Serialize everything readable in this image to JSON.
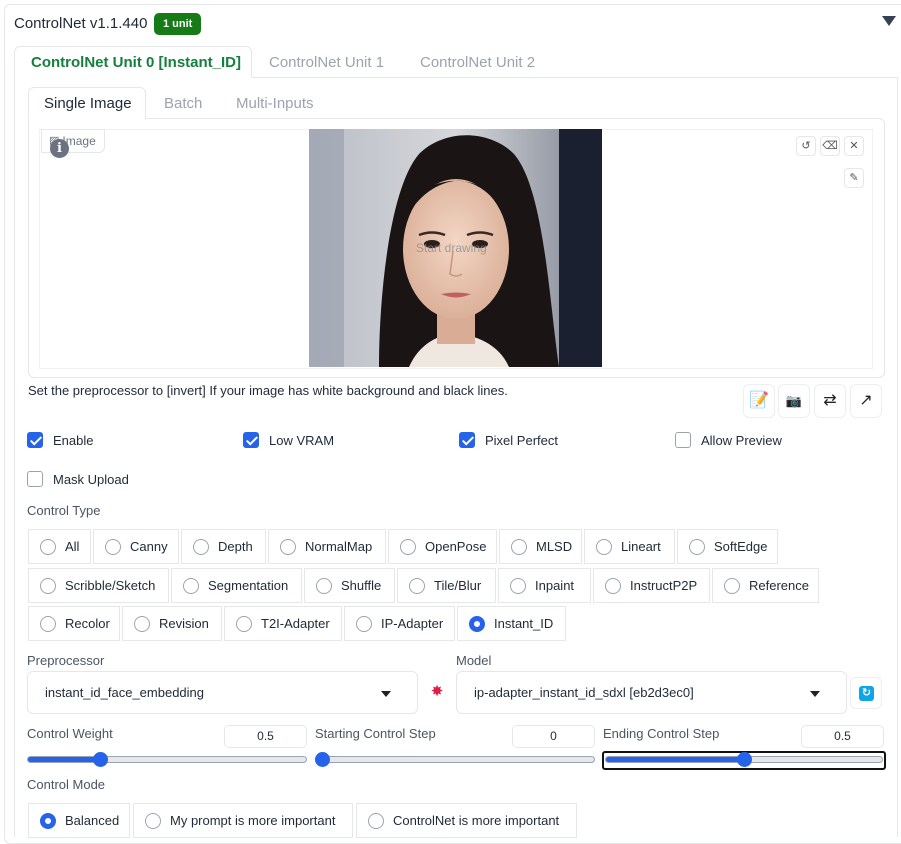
{
  "header": {
    "title": "ControlNet v1.1.440",
    "badge": "1 unit"
  },
  "unit_tabs": [
    {
      "label": "ControlNet Unit 0 [Instant_ID]",
      "active": true
    },
    {
      "label": "ControlNet Unit 1",
      "active": false
    },
    {
      "label": "ControlNet Unit 2",
      "active": false
    }
  ],
  "input_tabs": [
    {
      "label": "Single Image",
      "active": true
    },
    {
      "label": "Batch",
      "active": false
    },
    {
      "label": "Multi-Inputs",
      "active": false
    }
  ],
  "image_panel": {
    "label": "Image",
    "overlay_text": "Start drawing",
    "icons": [
      "undo-icon",
      "erase-icon",
      "close-icon",
      "brush-icon"
    ]
  },
  "hint": "Set the preprocessor to [invert] If your image has white background and black lines.",
  "tool_buttons": [
    {
      "name": "edit-image-icon",
      "glyph": "📝"
    },
    {
      "name": "camera-icon",
      "glyph": "📷"
    },
    {
      "name": "swap-icon",
      "glyph": "⇄"
    },
    {
      "name": "send-dimensions-icon",
      "glyph": "↗"
    }
  ],
  "checkboxes": {
    "enable": {
      "label": "Enable",
      "checked": true
    },
    "low_vram": {
      "label": "Low VRAM",
      "checked": true
    },
    "pixel_perfect": {
      "label": "Pixel Perfect",
      "checked": true
    },
    "allow_preview": {
      "label": "Allow Preview",
      "checked": false
    },
    "mask_upload": {
      "label": "Mask Upload",
      "checked": false
    }
  },
  "control_type": {
    "label": "Control Type",
    "options": [
      "All",
      "Canny",
      "Depth",
      "NormalMap",
      "OpenPose",
      "MLSD",
      "Lineart",
      "SoftEdge",
      "Scribble/Sketch",
      "Segmentation",
      "Shuffle",
      "Tile/Blur",
      "Inpaint",
      "InstructP2P",
      "Reference",
      "Recolor",
      "Revision",
      "T2I-Adapter",
      "IP-Adapter",
      "Instant_ID"
    ],
    "selected": "Instant_ID"
  },
  "preprocessor": {
    "label": "Preprocessor",
    "value": "instant_id_face_embedding"
  },
  "model": {
    "label": "Model",
    "value": "ip-adapter_instant_id_sdxl [eb2d3ec0]"
  },
  "sliders": {
    "control_weight": {
      "label": "Control Weight",
      "value": "0.5",
      "fraction": 0.25
    },
    "starting_step": {
      "label": "Starting Control Step",
      "value": "0",
      "fraction": 0.0
    },
    "ending_step": {
      "label": "Ending Control Step",
      "value": "0.5",
      "fraction": 0.5
    }
  },
  "control_mode": {
    "label": "Control Mode",
    "options": [
      "Balanced",
      "My prompt is more important",
      "ControlNet is more important"
    ],
    "selected": "Balanced"
  },
  "colors": {
    "accent": "#2563eb",
    "badge": "#167a16",
    "active_tab": "#15803d"
  }
}
